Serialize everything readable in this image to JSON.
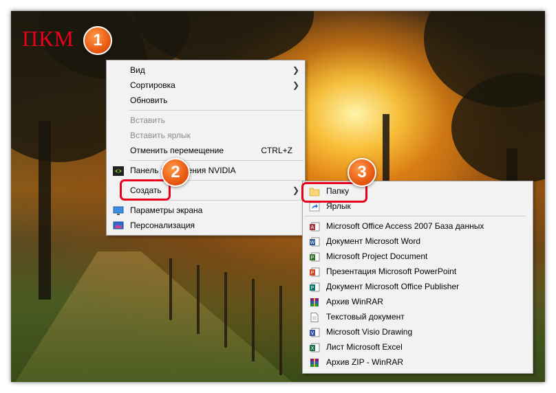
{
  "annotation": {
    "label": "ПКМ",
    "steps": [
      "1",
      "2",
      "3"
    ]
  },
  "context_menu": {
    "items": [
      {
        "label": "Вид",
        "arrow": "❯"
      },
      {
        "label": "Сортировка",
        "arrow": "❯"
      },
      {
        "label": "Обновить"
      },
      {
        "label": "Вставить"
      },
      {
        "label": "Вставить ярлык"
      },
      {
        "label": "Отменить перемещение",
        "shortcut": "CTRL+Z"
      },
      {
        "label": "Панель управления NVIDIA"
      },
      {
        "label": "Создать",
        "arrow": "❯"
      },
      {
        "label": "Параметры экрана"
      },
      {
        "label": "Персонализация"
      }
    ]
  },
  "submenu": {
    "items": [
      {
        "label": "Папку",
        "icon": "folder-icon"
      },
      {
        "label": "Ярлык",
        "icon": "shortcut-icon"
      },
      {
        "label": "Microsoft Office Access 2007 База данных",
        "icon": "access-icon"
      },
      {
        "label": "Документ Microsoft Word",
        "icon": "word-icon"
      },
      {
        "label": "Microsoft Project Document",
        "icon": "project-icon"
      },
      {
        "label": "Презентация Microsoft PowerPoint",
        "icon": "powerpoint-icon"
      },
      {
        "label": "Документ Microsoft Office Publisher",
        "icon": "publisher-icon"
      },
      {
        "label": "Архив WinRAR",
        "icon": "winrar-icon"
      },
      {
        "label": "Текстовый документ",
        "icon": "text-document-icon"
      },
      {
        "label": "Microsoft Visio Drawing",
        "icon": "visio-icon"
      },
      {
        "label": "Лист Microsoft Excel",
        "icon": "excel-icon"
      },
      {
        "label": "Архив ZIP - WinRAR",
        "icon": "zip-icon"
      }
    ]
  },
  "colors": {
    "annotation_red": "#e8001c",
    "badge_orange": "#e85a12",
    "menu_bg": "#f2f2f2"
  }
}
